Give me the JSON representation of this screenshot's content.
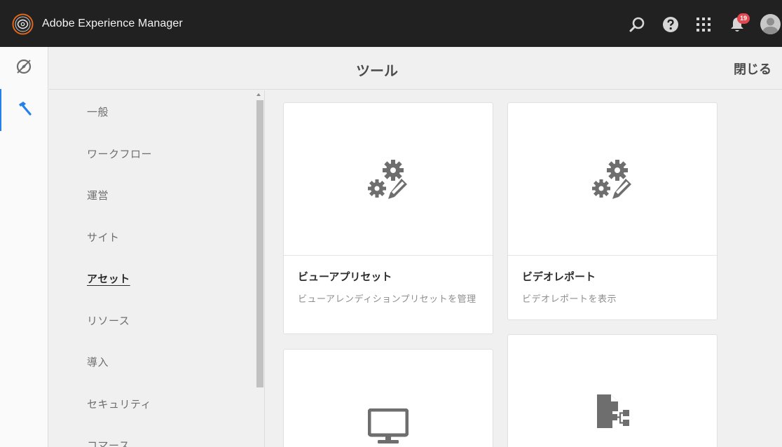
{
  "app": {
    "title": "Adobe Experience Manager",
    "notification_count": "19"
  },
  "icons": {
    "logo": "aem-logo-icon",
    "search": "search-icon",
    "help": "help-icon",
    "apps": "apps-grid-icon",
    "notifications": "bell-icon",
    "avatar": "user-avatar-icon",
    "rail_navigation": "compass-icon",
    "rail_tools": "hammer-icon"
  },
  "colors": {
    "topbar": "#212121",
    "accent": "#2680eb",
    "badge": "#e34850"
  },
  "header": {
    "title": "ツール",
    "close_label": "閉じる"
  },
  "categories": [
    {
      "label": "一般",
      "selected": false
    },
    {
      "label": "ワークフロー",
      "selected": false
    },
    {
      "label": "運営",
      "selected": false
    },
    {
      "label": "サイト",
      "selected": false
    },
    {
      "label": "アセット",
      "selected": true
    },
    {
      "label": "リソース",
      "selected": false
    },
    {
      "label": "導入",
      "selected": false
    },
    {
      "label": "セキュリティ",
      "selected": false
    },
    {
      "label": "コマース",
      "selected": false
    }
  ],
  "cards": [
    {
      "title": "ビューアプリセット",
      "description": "ビューアレンディションプリセットを管理",
      "icon": "gears-pencil-icon"
    },
    {
      "title": "ビデオレポート",
      "description": "ビデオレポートを表示",
      "icon": "gears-pencil-icon"
    },
    {
      "title": "",
      "description": "",
      "icon": "monitor-icon"
    },
    {
      "title": "",
      "description": "",
      "icon": "file-sitemap-icon"
    }
  ]
}
